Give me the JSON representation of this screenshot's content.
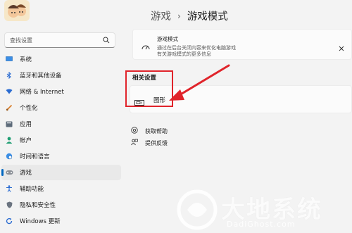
{
  "sidebar": {
    "search_placeholder": "查找设置",
    "items": [
      {
        "label": "系统",
        "icon": "monitor-icon"
      },
      {
        "label": "蓝牙和其他设备",
        "icon": "bluetooth-icon"
      },
      {
        "label": "网络 & Internet",
        "icon": "wifi-icon"
      },
      {
        "label": "个性化",
        "icon": "brush-icon"
      },
      {
        "label": "应用",
        "icon": "apps-icon"
      },
      {
        "label": "帐户",
        "icon": "person-icon"
      },
      {
        "label": "时间和语言",
        "icon": "globe-clock-icon"
      },
      {
        "label": "游戏",
        "icon": "gamepad-icon",
        "selected": true
      },
      {
        "label": "辅助功能",
        "icon": "accessibility-icon"
      },
      {
        "label": "隐私和安全性",
        "icon": "shield-icon"
      },
      {
        "label": "Windows 更新",
        "icon": "update-icon"
      }
    ]
  },
  "breadcrumb": {
    "parent": "游戏",
    "separator": "›",
    "current": "游戏模式"
  },
  "game_mode_card": {
    "title": "游戏模式",
    "description_line1": "通过在后台关闭内容来优化电脑游戏",
    "description_line2": "有关游戏模式的更多信息"
  },
  "related_settings": {
    "title": "相关设置",
    "graphics_label": "图形"
  },
  "help_links": [
    {
      "label": "获取帮助",
      "icon": "help-icon"
    },
    {
      "label": "提供反馈",
      "icon": "feedback-icon"
    }
  ],
  "watermark": {
    "brand": "大地系统",
    "domain": "DadiGhost.com"
  },
  "colors": {
    "accent": "#0067c0",
    "annotation": "#e0242b"
  }
}
